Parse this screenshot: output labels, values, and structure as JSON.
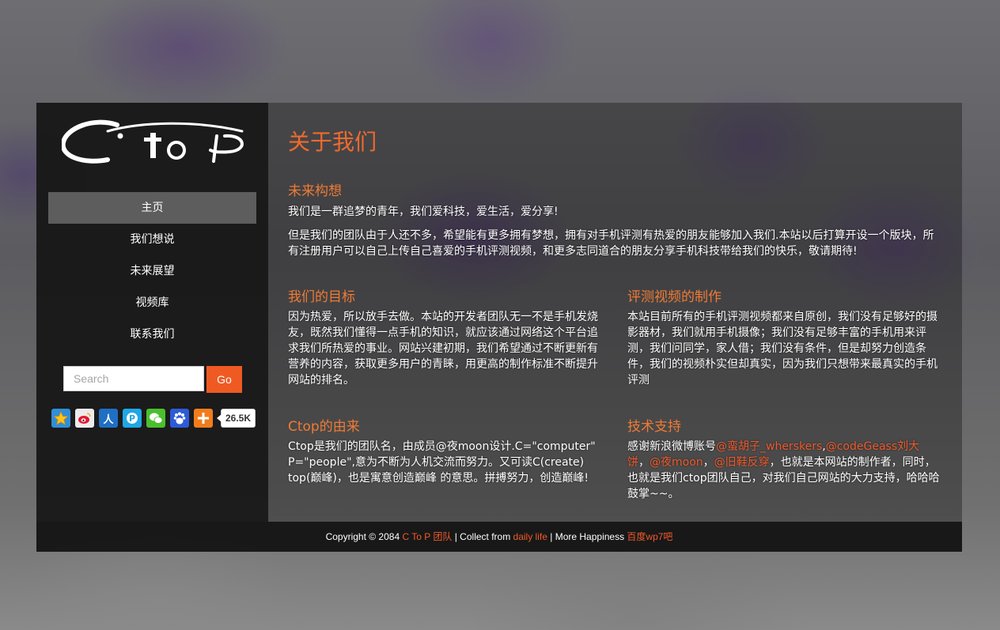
{
  "logo": {
    "text": "Ctop"
  },
  "nav": {
    "items": [
      {
        "label": "主页",
        "active": true
      },
      {
        "label": "我们想说"
      },
      {
        "label": "未来展望"
      },
      {
        "label": "视频库"
      },
      {
        "label": "联系我们"
      }
    ]
  },
  "search": {
    "placeholder": "Search",
    "button_label": "Go"
  },
  "share": {
    "icons": [
      "qzone-icon",
      "weibo-icon",
      "renren-icon",
      "tencent-pengyou-icon",
      "wechat-icon",
      "baidu-icon",
      "more-share-icon"
    ],
    "count": "26.5K"
  },
  "main": {
    "title": "关于我们",
    "sections": {
      "future": {
        "title": "未来构想",
        "p1": "我们是一群追梦的青年，我们爱科技，爱生活，爱分享!",
        "p2": "但是我们的团队由于人还不多，希望能有更多拥有梦想，拥有对手机评测有热爱的朋友能够加入我们.本站以后打算开设一个版块，所有注册用户可以自己上传自己喜爱的手机评测视频，和更多志同道合的朋友分享手机科技带给我们的快乐，敬请期待!"
      },
      "goal": {
        "title": "我们的目标",
        "text": "因为热爱，所以放手去做。本站的开发者团队无一不是手机发烧友，既然我们懂得一点手机的知识，就应该通过网络这个平台追求我们所热爱的事业。网站兴建初期，我们希望通过不断更新有营养的内容，获取更多用户的青睐，用更高的制作标准不断提升网站的排名。"
      },
      "video": {
        "title": "评测视频的制作",
        "text": "本站目前所有的手机评测视频都来自原创，我们没有足够好的摄影器材，我们就用手机摄像；我们没有足够丰富的手机用来评测，我们问同学，家人借；我们没有条件，但是却努力创造条件，我们的视频朴实但却真实，因为我们只想带来最真实的手机评测"
      },
      "origin": {
        "title": "Ctop的由来",
        "text": "Ctop是我们的团队名，由成员@夜moon设计.C=\"computer\" P=\"people\",意为不断为人机交流而努力。又可读C(create) top(巅峰)，也是寓意创造巅峰 的意思。拼搏努力，创造巅峰!"
      },
      "tech": {
        "title": "技术支持",
        "prefix": "感谢新浪微博账号",
        "acc1": "@蛮胡子_wherskers",
        "sep1": ",",
        "acc2": "@codeGeass刘大饼",
        "sep2": "，",
        "acc3": "@夜moon",
        "sep3": "，",
        "acc4": "@旧鞋反穿",
        "suffix": "，也就是本网站的制作者，同时，也就是我们ctop团队自己，对我们自己网站的大力支持，哈哈哈鼓掌~~。"
      }
    }
  },
  "footer": {
    "copyright": "Copyright © 2084",
    "team_link": "C To P 团队",
    "collect_text": "| Collect from",
    "collect_link": "daily life",
    "more_text": "| More Happiness",
    "bar_link": "百度wp7吧"
  },
  "colors": {
    "accent": "#f05a2a",
    "heading": "#f07a33",
    "title": "#f06a2d",
    "nav_active_bg": "#5d5d5d"
  }
}
